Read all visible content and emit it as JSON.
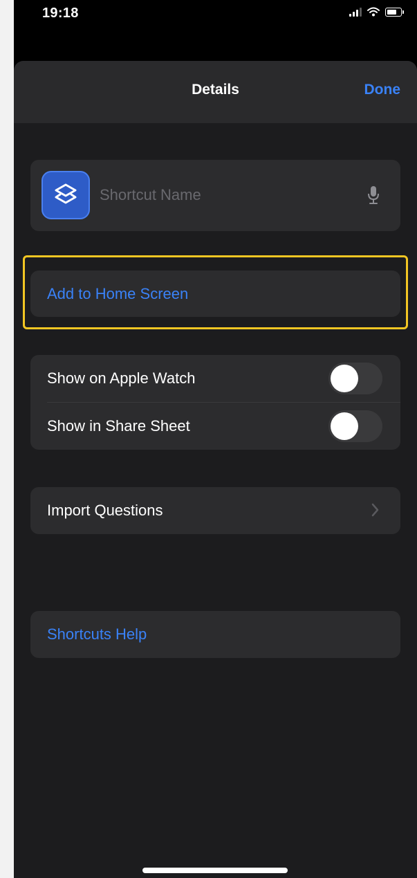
{
  "status_bar": {
    "time": "19:18"
  },
  "nav": {
    "title": "Details",
    "done_label": "Done"
  },
  "shortcut": {
    "name_placeholder": "Shortcut Name",
    "name_value": ""
  },
  "actions": {
    "add_to_home": "Add to Home Screen"
  },
  "toggles": [
    {
      "label": "Show on Apple Watch",
      "on": false
    },
    {
      "label": "Show in Share Sheet",
      "on": false
    }
  ],
  "import": {
    "label": "Import Questions"
  },
  "help": {
    "label": "Shortcuts Help"
  },
  "colors": {
    "accent": "#3a82f7",
    "highlight": "#f3c623",
    "sheet_bg": "#1c1c1e",
    "card_bg": "#2c2c2e"
  },
  "icons": [
    "signal-icon",
    "wifi-icon",
    "battery-icon",
    "shortcuts-icon",
    "mic-icon",
    "chevron-right-icon"
  ]
}
